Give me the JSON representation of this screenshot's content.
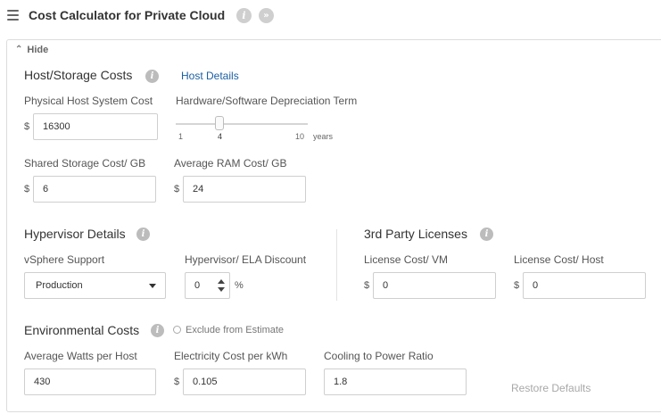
{
  "header": {
    "title": "Cost Calculator for Private Cloud",
    "info_icon": "i",
    "more_icon": "»"
  },
  "panel": {
    "hide_label": "Hide"
  },
  "host_storage": {
    "title": "Host/Storage Costs",
    "details_link": "Host Details",
    "host_cost_label": "Physical Host System Cost",
    "host_cost_currency": "$",
    "host_cost_value": "16300",
    "depreciation_label": "Hardware/Software Depreciation Term",
    "depreciation": {
      "min": "1",
      "value": "4",
      "max": "10",
      "unit": "years",
      "fraction": 0.333
    },
    "storage_label": "Shared Storage Cost/ GB",
    "storage_currency": "$",
    "storage_value": "6",
    "ram_label": "Average RAM Cost/ GB",
    "ram_currency": "$",
    "ram_value": "24"
  },
  "hypervisor": {
    "title": "Hypervisor Details",
    "support_label": "vSphere Support",
    "support_value": "Production",
    "discount_label": "Hypervisor/ ELA Discount",
    "discount_value": "0",
    "discount_unit": "%"
  },
  "licenses": {
    "title": "3rd Party Licenses",
    "vm_label": "License Cost/ VM",
    "vm_currency": "$",
    "vm_value": "0",
    "host_label": "License Cost/ Host",
    "host_currency": "$",
    "host_value": "0"
  },
  "environmental": {
    "title": "Environmental Costs",
    "exclude_label": "Exclude from Estimate",
    "watts_label": "Average Watts per Host",
    "watts_value": "430",
    "electricity_label": "Electricity Cost per kWh",
    "electricity_currency": "$",
    "electricity_value": "0.105",
    "cooling_label": "Cooling to Power Ratio",
    "cooling_value": "1.8",
    "restore_label": "Restore Defaults"
  },
  "icons": [
    "menu-icon",
    "info-icon",
    "more-icon",
    "collapse-icon",
    "dropdown-caret-icon",
    "spinner-icon"
  ]
}
